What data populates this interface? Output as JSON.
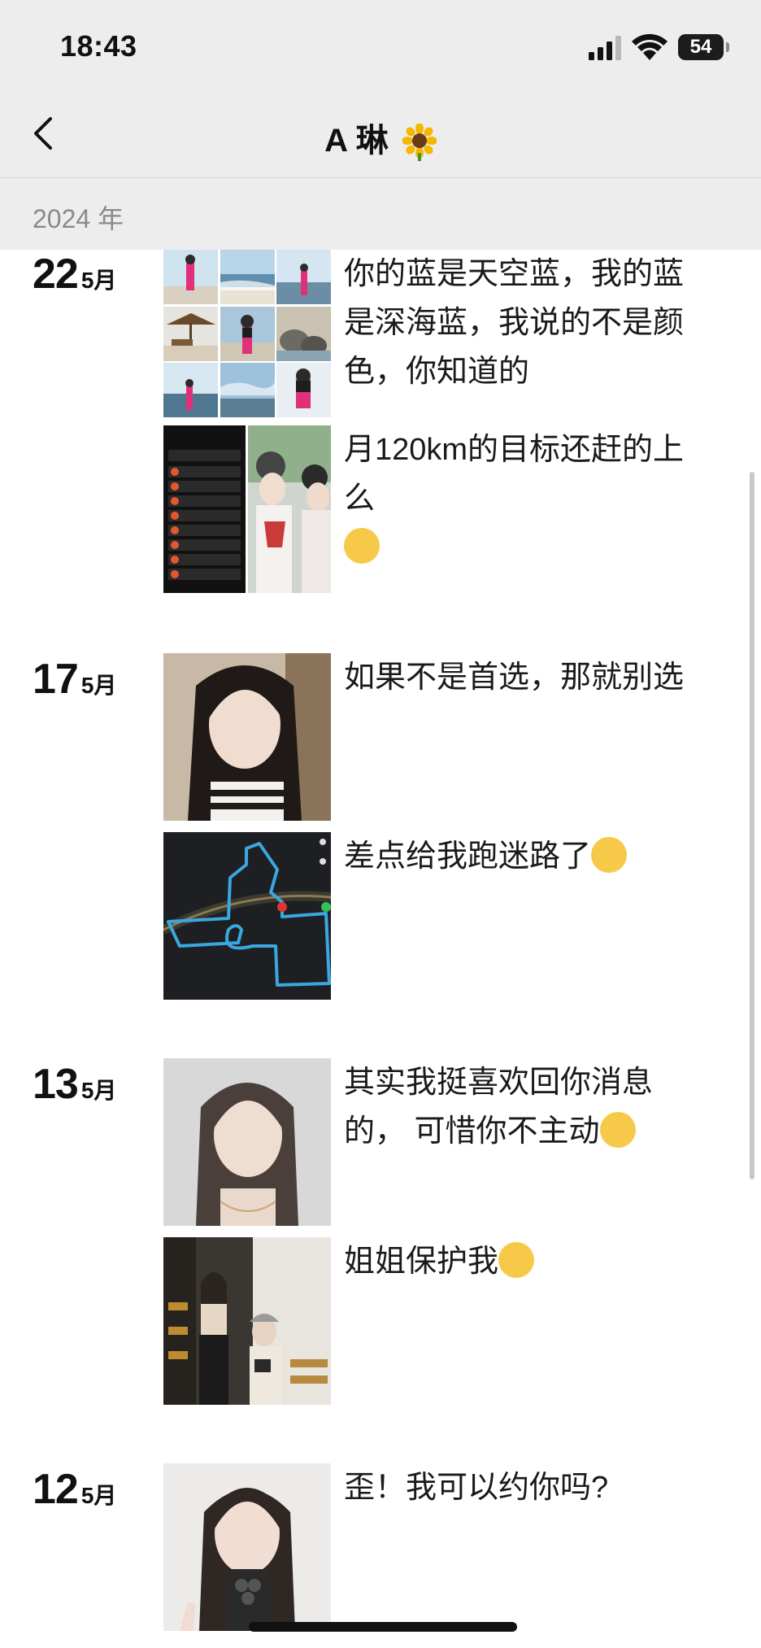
{
  "status": {
    "time": "18:43",
    "battery": "54"
  },
  "nav": {
    "title": "A 琳"
  },
  "year": "2024 年",
  "entries": [
    {
      "day": "22",
      "month": "5月",
      "posts": [
        {
          "text": "你的蓝是天空蓝，我的蓝是深海蓝，我说的不是颜色，你知道的"
        },
        {
          "text": "月120km的目标还赶的上么"
        }
      ]
    },
    {
      "day": "17",
      "month": "5月",
      "posts": [
        {
          "text": "如果不是首选，那就别选"
        },
        {
          "text": "差点给我跑迷路了"
        }
      ]
    },
    {
      "day": "13",
      "month": "5月",
      "posts": [
        {
          "text": "其实我挺喜欢回你消息的， 可惜你不主动"
        },
        {
          "text": "姐姐保护我"
        }
      ]
    },
    {
      "day": "12",
      "month": "5月",
      "posts": [
        {
          "text": "歪！我可以约你吗?"
        }
      ]
    }
  ]
}
